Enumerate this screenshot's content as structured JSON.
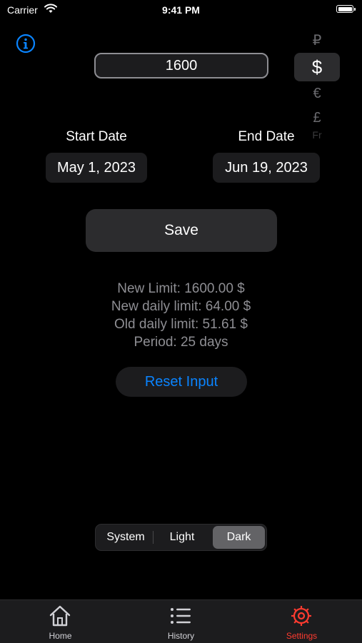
{
  "status_bar": {
    "carrier": "Carrier",
    "time": "9:41 PM"
  },
  "limit_input": {
    "value": "1600"
  },
  "currency_picker": {
    "options": [
      "₽",
      "$",
      "€",
      "£",
      "Fr"
    ],
    "selected": "$"
  },
  "start_date": {
    "label": "Start Date",
    "value": "May 1, 2023"
  },
  "end_date": {
    "label": "End Date",
    "value": "Jun 19, 2023"
  },
  "save_label": "Save",
  "summary": {
    "new_limit": "New Limit: 1600.00 $",
    "new_daily_limit": "New daily limit: 64.00 $",
    "old_daily_limit": "Old daily limit: 51.61 $",
    "period": "Period: 25 days"
  },
  "reset_label": "Reset Input",
  "appearance": {
    "options": [
      "System",
      "Light",
      "Dark"
    ],
    "selected": "Dark"
  },
  "tabs": [
    {
      "label": "Home",
      "icon": "house-icon"
    },
    {
      "label": "History",
      "icon": "list-icon"
    },
    {
      "label": "Settings",
      "icon": "gear-icon",
      "active": true
    }
  ],
  "colors": {
    "accent": "#0a84ff",
    "active_tab": "#ff3b30",
    "background": "#000000"
  }
}
